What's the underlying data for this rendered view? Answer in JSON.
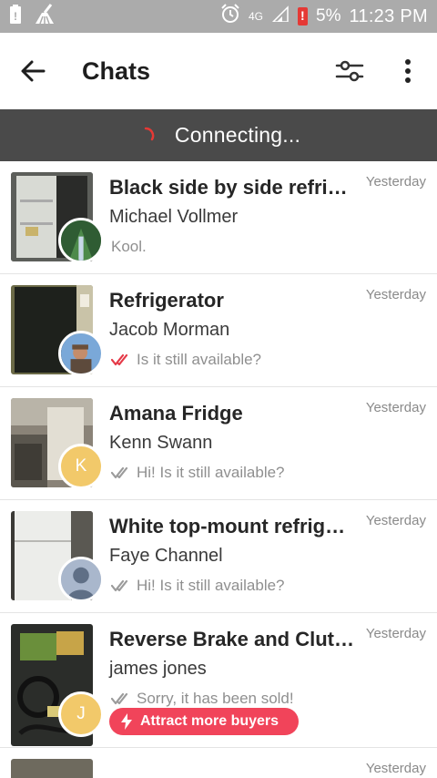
{
  "status_bar": {
    "network": "4G",
    "battery": "5%",
    "time": "11:23 PM"
  },
  "app_bar": {
    "title": "Chats",
    "icons": [
      "back-arrow-icon",
      "filter-sliders-icon",
      "more-vert-icon"
    ]
  },
  "banner": {
    "text": "Connecting...",
    "accent": "#e53935"
  },
  "chats": [
    {
      "title": "Black side by side refrigerator",
      "user": "Michael Vollmer",
      "time": "Yesterday",
      "message": "Kool.",
      "check_color": ""
    },
    {
      "title": "Refrigerator",
      "user": "Jacob Morman",
      "time": "Yesterday",
      "message": "Is it still available?",
      "check_color": "#e53947"
    },
    {
      "title": "Amana Fridge",
      "user": "Kenn Swann",
      "time": "Yesterday",
      "message": "Hi! Is it still available?",
      "avatar_letter": "K",
      "check_color": "#9b9b9b"
    },
    {
      "title": "White top-mount refrigerator",
      "user": "Faye Channel",
      "time": "Yesterday",
      "message": "Hi! Is it still available?",
      "check_color": "#9b9b9b"
    },
    {
      "title": "Reverse Brake and Clutch",
      "user": "james jones",
      "time": "Yesterday",
      "message": "Sorry, it has been sold!",
      "avatar_letter": "J",
      "check_color": "#9b9b9b",
      "promo": "Attract more buyers"
    },
    {
      "time": "Yesterday"
    }
  ]
}
